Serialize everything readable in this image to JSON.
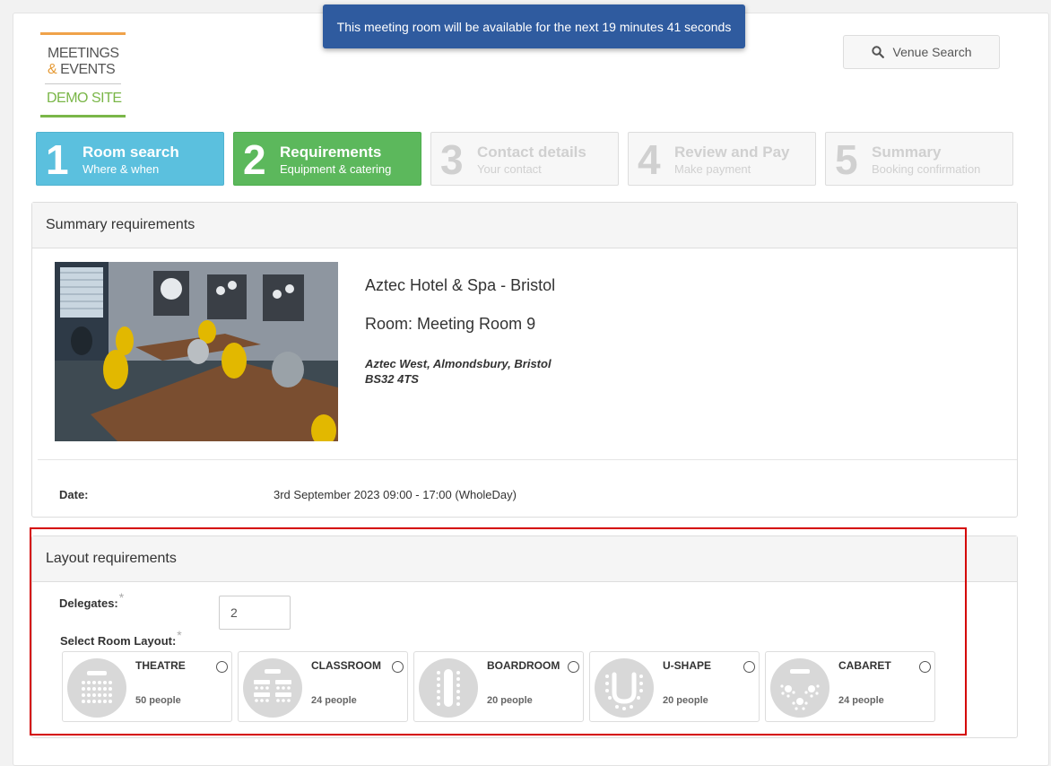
{
  "toast": {
    "message": "This meeting room will be available for the next 19 minutes 41 seconds"
  },
  "logo": {
    "line1": "MEETINGS",
    "line2_amp": "&",
    "line2": " EVENTS",
    "line3": "DEMO SITE"
  },
  "header": {
    "venue_search_label": "Venue Search",
    "venue_search_icon": "search-icon"
  },
  "steps": [
    {
      "num": "1",
      "title": "Room search",
      "subtitle": "Where & when",
      "state": "done"
    },
    {
      "num": "2",
      "title": "Requirements",
      "subtitle": "Equipment & catering",
      "state": "current"
    },
    {
      "num": "3",
      "title": "Contact details",
      "subtitle": "Your contact",
      "state": "pending"
    },
    {
      "num": "4",
      "title": "Review and Pay",
      "subtitle": "Make payment",
      "state": "pending"
    },
    {
      "num": "5",
      "title": "Summary",
      "subtitle": "Booking confirmation",
      "state": "pending"
    }
  ],
  "summary": {
    "heading": "Summary requirements",
    "hotel": "Aztec Hotel & Spa - Bristol",
    "room": "Room: Meeting Room 9",
    "address_line1": "Aztec West, Almondsbury, Bristol",
    "address_line2": "BS32 4TS",
    "date_label": "Date:",
    "date_value": "3rd September 2023 09:00 - 17:00 (WholeDay)"
  },
  "layout": {
    "heading": "Layout requirements",
    "delegates_label": "Delegates:",
    "delegates_value": "2",
    "select_label": "Select Room Layout:",
    "required_mark": "*",
    "options": [
      {
        "name": "THEATRE",
        "capacity": "50 people",
        "icon": "theatre-icon"
      },
      {
        "name": "CLASSROOM",
        "capacity": "24 people",
        "icon": "classroom-icon"
      },
      {
        "name": "BOARDROOM",
        "capacity": "20 people",
        "icon": "boardroom-icon"
      },
      {
        "name": "U-SHAPE",
        "capacity": "20 people",
        "icon": "u-shape-icon"
      },
      {
        "name": "CABARET",
        "capacity": "24 people",
        "icon": "cabaret-icon"
      }
    ]
  },
  "colors": {
    "step_done": "#5bc0de",
    "step_current": "#5cb85c",
    "toast": "#2f5b9f",
    "highlight": "#d40000"
  }
}
